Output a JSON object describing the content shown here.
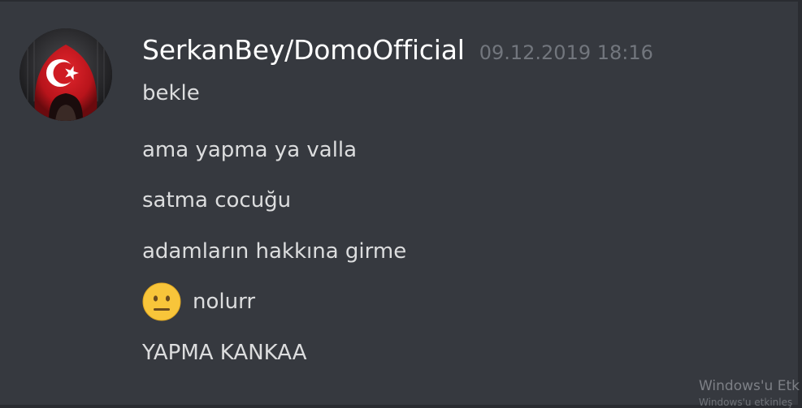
{
  "message": {
    "author": "SerkanBey/DomoOfficial",
    "timestamp": "09.12.2019 18:16",
    "avatar_icon": "turkish-flag-hooded-avatar",
    "lines": [
      "bekle",
      "ama yapma ya valla",
      "satma cocuğu",
      "adamların hakkına girme",
      "nolurr",
      "YAPMA KANKAA"
    ],
    "emoji_icon": "neutral-face-emoji"
  },
  "watermark": {
    "title": "Windows'u Etk",
    "subtitle": "Windows'u etkinleş"
  },
  "colors": {
    "background": "#36393f",
    "username": "#ffffff",
    "text": "#dcddde",
    "timestamp": "#72767d",
    "emoji": "#f8c53a"
  }
}
